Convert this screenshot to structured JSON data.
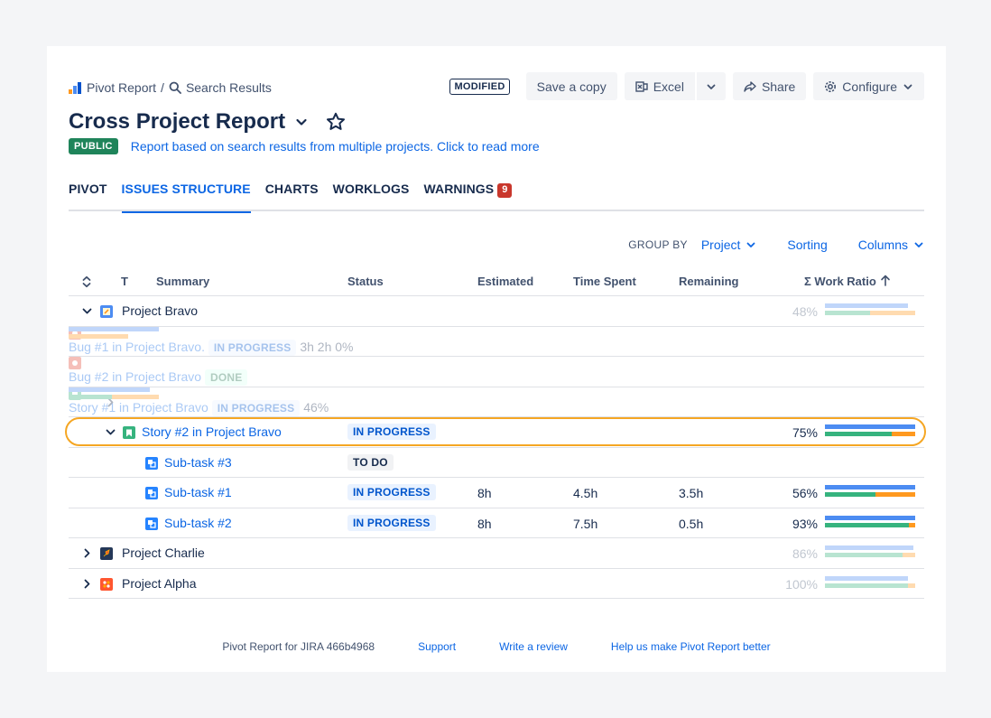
{
  "breadcrumb": {
    "root": "Pivot Report",
    "separator": "/",
    "current": "Search Results"
  },
  "actions": {
    "modified_badge": "MODIFIED",
    "save_copy": "Save a copy",
    "excel": "Excel",
    "share": "Share",
    "configure": "Configure"
  },
  "report": {
    "title": "Cross Project Report",
    "visibility": "PUBLIC",
    "description": "Report based on search results from multiple projects. Click to read more"
  },
  "tabs": [
    {
      "label": "PIVOT"
    },
    {
      "label": "ISSUES STRUCTURE"
    },
    {
      "label": "CHARTS"
    },
    {
      "label": "WORKLOGS"
    },
    {
      "label": "WARNINGS",
      "count": "9"
    }
  ],
  "toolbar": {
    "group_by_label": "GROUP BY",
    "group_by_value": "Project",
    "sorting": "Sorting",
    "columns": "Columns"
  },
  "columns": {
    "type": "T",
    "summary": "Summary",
    "status": "Status",
    "estimated": "Estimated",
    "time_spent": "Time Spent",
    "remaining": "Remaining",
    "work_ratio": "Σ Work Ratio"
  },
  "rows": [
    {
      "summary": "Project Bravo",
      "status": "",
      "estimated": "",
      "time_spent": "",
      "remaining": "",
      "work_ratio": "48%",
      "bar_total": 0.92,
      "bar_spent": 0.5,
      "bar_remaining": 0.5
    },
    {
      "summary": "Bug #1 in Project Bravo.",
      "status": "IN PROGRESS",
      "estimated": "3h",
      "time_spent": "",
      "remaining": "2h",
      "work_ratio": "0%",
      "bar_total": 1.0,
      "bar_spent": 0.0,
      "bar_remaining": 0.66
    },
    {
      "summary": "Bug #2 in Project Bravo",
      "status": "DONE",
      "estimated": "",
      "time_spent": "",
      "remaining": "",
      "work_ratio": ""
    },
    {
      "summary": "Story #1 in Project Bravo",
      "status": "IN PROGRESS",
      "estimated": "",
      "time_spent": "",
      "remaining": "",
      "work_ratio": "46%",
      "bar_total": 0.9,
      "bar_spent": 0.48,
      "bar_remaining": 0.52
    },
    {
      "summary": "Story #2 in Project Bravo",
      "status": "IN PROGRESS",
      "estimated": "",
      "time_spent": "",
      "remaining": "",
      "work_ratio": "75%",
      "bar_total": 1.0,
      "bar_spent": 0.74,
      "bar_remaining": 0.26
    },
    {
      "summary": "Sub-task #3",
      "status": "TO DO",
      "estimated": "",
      "time_spent": "",
      "remaining": "",
      "work_ratio": ""
    },
    {
      "summary": "Sub-task #1",
      "status": "IN PROGRESS",
      "estimated": "8h",
      "time_spent": "4.5h",
      "remaining": "3.5h",
      "work_ratio": "56%",
      "bar_total": 1.0,
      "bar_spent": 0.56,
      "bar_remaining": 0.44
    },
    {
      "summary": "Sub-task #2",
      "status": "IN PROGRESS",
      "estimated": "8h",
      "time_spent": "7.5h",
      "remaining": "0.5h",
      "work_ratio": "93%",
      "bar_total": 1.0,
      "bar_spent": 0.93,
      "bar_remaining": 0.07
    },
    {
      "summary": "Project Charlie",
      "status": "",
      "estimated": "",
      "time_spent": "",
      "remaining": "",
      "work_ratio": "86%",
      "bar_total": 0.98,
      "bar_spent": 0.86,
      "bar_remaining": 0.14
    },
    {
      "summary": "Project Alpha",
      "status": "",
      "estimated": "",
      "time_spent": "",
      "remaining": "",
      "work_ratio": "100%",
      "bar_total": 0.92,
      "bar_spent": 0.92,
      "bar_remaining": 0.08
    }
  ],
  "footer": {
    "version": "Pivot Report for JIRA 466b4968",
    "support": "Support",
    "review": "Write a review",
    "feedback": "Help us make Pivot Report better"
  },
  "colors": {
    "accent": "#0c66e4",
    "bar_estimate": "#4c8cf2",
    "bar_spent": "#36b37e",
    "bar_remaining": "#ff991f",
    "highlight": "#f5a623",
    "warning_badge": "#c9372c",
    "public_badge": "#1f845a"
  },
  "icons": {
    "project_bravo": "notepad-icon",
    "project_charlie": "rocket-icon",
    "project_alpha": "puzzle-icon",
    "bug": "bug-icon",
    "story": "bookmark-icon",
    "subtask": "subtask-icon"
  }
}
